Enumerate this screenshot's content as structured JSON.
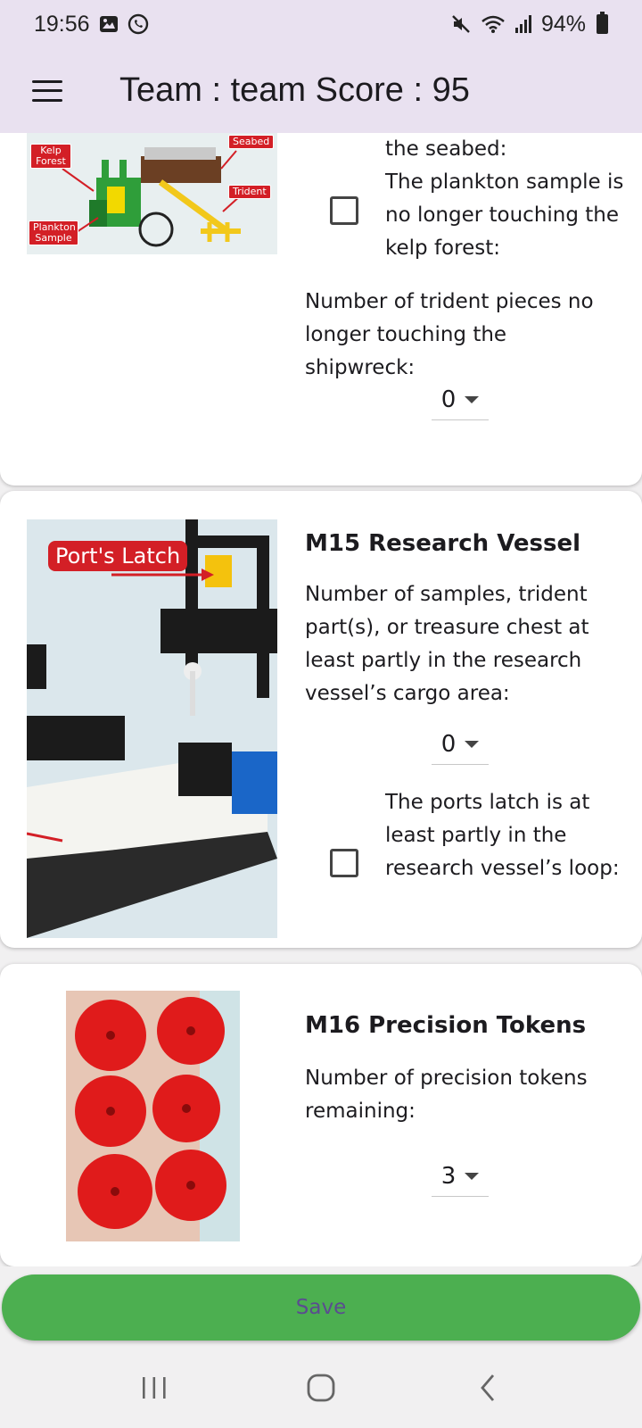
{
  "status_bar": {
    "time": "19:56",
    "battery": "94%",
    "left_icons": [
      "image-icon",
      "whatsapp-icon"
    ],
    "right_icons": [
      "mute-icon",
      "wifi-icon",
      "signal-icon",
      "battery-icon"
    ]
  },
  "app_bar": {
    "title": "Team : team Score : 95"
  },
  "cards": {
    "m14": {
      "image_labels": [
        "Kelp Forest",
        "Seabed",
        "Trident",
        "Plankton Sample"
      ],
      "check_text_partial": "the seabed:",
      "check_label": "The plankton sample is no longer touching the kelp forest:",
      "question": "Number of trident pieces no longer touching the shipwreck:",
      "dropdown_value": "0"
    },
    "m15": {
      "title": "M15 Research Vessel",
      "image_label": "Port's Latch",
      "question": "Number of samples, trident part(s), or treasure chest at least partly in the research vessel’s cargo area:",
      "dropdown_value": "0",
      "check_label": "The ports latch is at least partly in the research vessel’s loop:"
    },
    "m16": {
      "title": "M16 Precision Tokens",
      "question": "Number of precision tokens remaining:",
      "dropdown_value": "3"
    }
  },
  "save_button": {
    "label": "Save"
  },
  "colors": {
    "app_bar_bg": "#e9e1f0",
    "save_button_bg": "#4caf50",
    "save_label": "#5a4d8f",
    "badge_red": "#d31f26"
  }
}
